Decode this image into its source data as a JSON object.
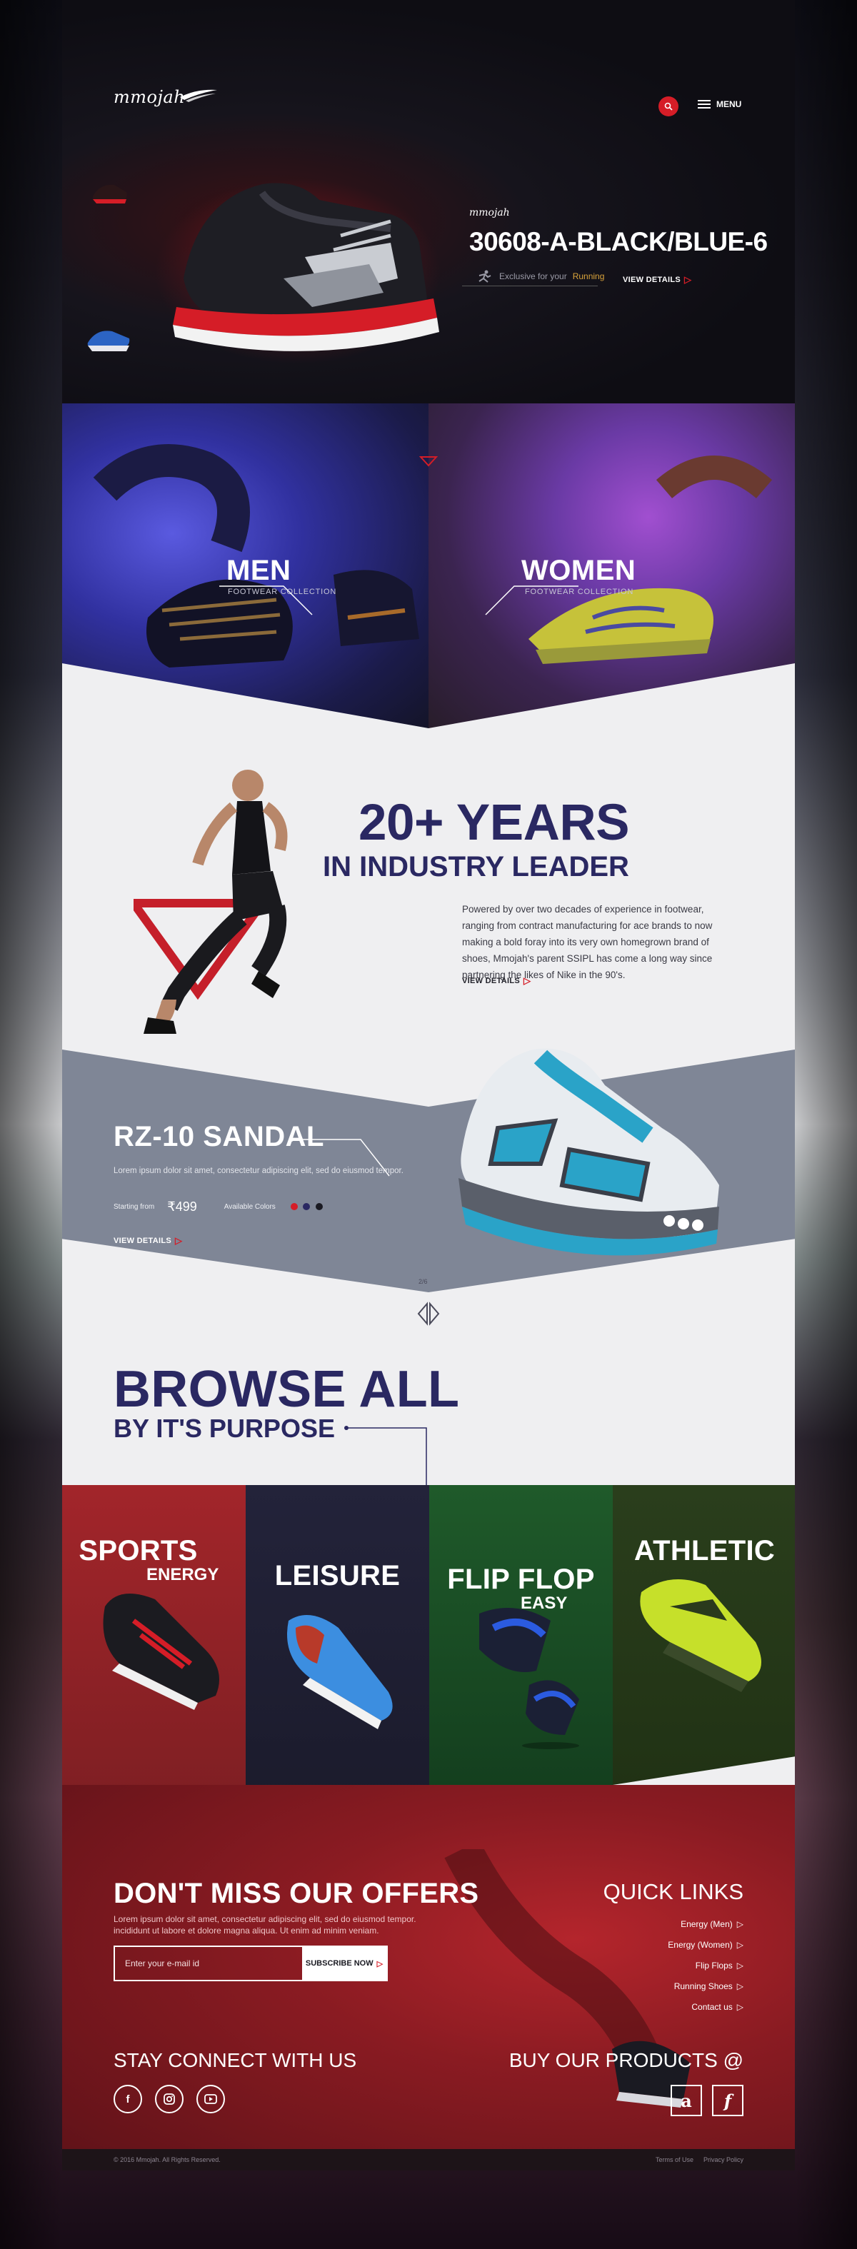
{
  "header": {
    "logo_text": "mmojah",
    "menu_label": "MENU"
  },
  "hero": {
    "brand": "mmojah",
    "title": "30608-A-BLACK/BLUE-6",
    "tag_prefix": "Exclusive for your",
    "tag_highlight": "Running",
    "view_label": "VIEW DETAILS"
  },
  "categories_gender": [
    {
      "title": "MEN",
      "sub": "FOOTWEAR COLLECTION"
    },
    {
      "title": "WOMEN",
      "sub": "FOOTWEAR COLLECTION"
    }
  ],
  "about": {
    "title_line1": "20+ YEARS",
    "title_line2": "IN INDUSTRY LEADER",
    "paragraph": "Powered by over two decades of experience in footwear, ranging from contract manufacturing for ace brands to now making a bold foray into its very own homegrown brand of shoes, Mmojah's parent SSIPL has come a long way since partnering the likes of Nike in the 90's.",
    "view_label": "VIEW DETAILS"
  },
  "featured": {
    "title": "RZ-10 SANDAL",
    "desc": "Lorem ipsum dolor sit amet, consectetur adipiscing elit, sed do eiusmod tempor.",
    "starting_label": "Starting from",
    "price": "₹499",
    "colors_label": "Available Colors",
    "colors": [
      "#d51d27",
      "#2a2862",
      "#1a1a22"
    ],
    "view_label": "VIEW DETAILS",
    "slide_counter": "2/6"
  },
  "browse": {
    "line1": "BROWSE ALL",
    "line2": "BY IT'S PURPOSE"
  },
  "purposes": [
    {
      "name": "SPORTS",
      "sub": "ENERGY"
    },
    {
      "name": "LEISURE",
      "sub": ""
    },
    {
      "name": "FLIP FLOP",
      "sub": "EASY"
    },
    {
      "name": "ATHLETIC",
      "sub": ""
    }
  ],
  "offers": {
    "title": "DON'T MISS OUR OFFERS",
    "text": "Lorem ipsum dolor sit amet, consectetur adipiscing elit, sed do eiusmod tempor. incididunt ut labore et dolore magna aliqua. Ut enim ad minim veniam.",
    "email_placeholder": "Enter your e-mail id",
    "subscribe_label": "SUBSCRIBE NOW"
  },
  "quick_links": {
    "title": "QUICK LINKS",
    "items": [
      "Energy (Men)",
      "Energy (Women)",
      "Flip Flops",
      "Running Shoes",
      "Contact us"
    ]
  },
  "connect": {
    "title": "STAY CONNECT WITH US"
  },
  "buy": {
    "title": "BUY OUR PRODUCTS @"
  },
  "footer": {
    "copyright": "© 2016 Mmojah. All Rights Reserved.",
    "terms": "Terms of Use",
    "privacy": "Privacy Policy"
  },
  "colors": {
    "accent": "#d51d27",
    "navy": "#2a2862"
  }
}
